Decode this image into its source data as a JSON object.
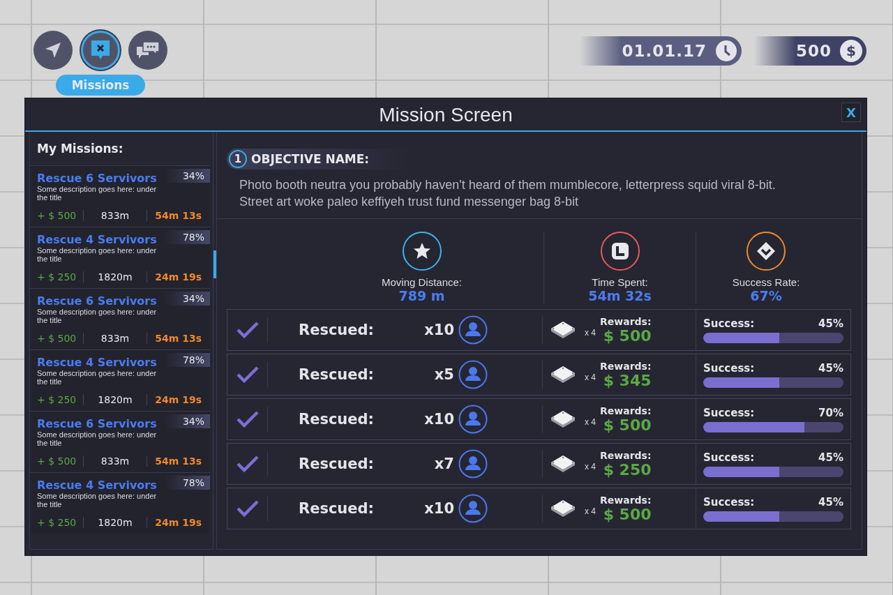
{
  "nav_buttons": [
    {
      "kind": "navigate",
      "selected": false
    },
    {
      "kind": "missions",
      "selected": true
    },
    {
      "kind": "chat",
      "selected": false
    }
  ],
  "tooltip": "Missions",
  "date": "01.01.17",
  "money": {
    "amount": "500",
    "symbol": "$"
  },
  "window": {
    "title": "Mission Screen",
    "close": "X"
  },
  "sidebar": {
    "title": "My Missions:",
    "items": [
      {
        "title": "Rescue 6 Servivors",
        "percent": "34%",
        "description": "Some description goes here: under the title",
        "reward": "+ $ 500",
        "distance": "833m",
        "time": "54m 13s"
      },
      {
        "title": "Rescue 4 Servivors",
        "percent": "78%",
        "description": "Some description goes here: under the title",
        "reward": "+ $ 250",
        "distance": "1820m",
        "time": "24m 19s"
      },
      {
        "title": "Rescue 6 Servivors",
        "percent": "34%",
        "description": "Some description goes here: under the title",
        "reward": "+ $ 500",
        "distance": "833m",
        "time": "54m 13s"
      },
      {
        "title": "Rescue 4 Servivors",
        "percent": "78%",
        "description": "Some description goes here: under the title",
        "reward": "+ $ 250",
        "distance": "1820m",
        "time": "24m 19s"
      },
      {
        "title": "Rescue 6 Servivors",
        "percent": "34%",
        "description": "Some description goes here: under the title",
        "reward": "+ $ 500",
        "distance": "833m",
        "time": "54m 13s"
      },
      {
        "title": "Rescue 4 Servivors",
        "percent": "78%",
        "description": "Some description goes here: under the title",
        "reward": "+ $ 250",
        "distance": "1820m",
        "time": "24m 19s"
      }
    ]
  },
  "objective": {
    "number": "1",
    "title": "OBJECTIVE NAME:",
    "description": "Photo booth neutra you probably haven't heard of them mumblecore, letterpress squid viral 8-bit. Street art woke paleo keffiyeh trust fund messenger bag 8-bit"
  },
  "stats": [
    {
      "kind": "star",
      "color": "#3cb4e8",
      "label": "Moving Distance:",
      "value": "789 m"
    },
    {
      "kind": "clock",
      "color": "#e85a5a",
      "label": "Time Spent:",
      "value": "54m 32s"
    },
    {
      "kind": "diamond",
      "color": "#f0892a",
      "label": "Success Rate:",
      "value": "67%"
    }
  ],
  "rows": [
    {
      "checked": true,
      "label": "Rescued:",
      "count": "x10",
      "multiplier": "x 4",
      "rewards_label": "Rewards:",
      "reward": "$ 500",
      "success_label": "Success:",
      "percent": "45%",
      "level": 0.54
    },
    {
      "checked": true,
      "label": "Rescued:",
      "count": "x5",
      "multiplier": "x 4",
      "rewards_label": "Rewards:",
      "reward": "$ 345",
      "success_label": "Success:",
      "percent": "45%",
      "level": 0.54
    },
    {
      "checked": true,
      "label": "Rescued:",
      "count": "x10",
      "multiplier": "x 4",
      "rewards_label": "Rewards:",
      "reward": "$ 500",
      "success_label": "Success:",
      "percent": "70%",
      "level": 0.72
    },
    {
      "checked": true,
      "label": "Rescued:",
      "count": "x7",
      "multiplier": "x 4",
      "rewards_label": "Rewards:",
      "reward": "$ 250",
      "success_label": "Success:",
      "percent": "45%",
      "level": 0.54
    },
    {
      "checked": true,
      "label": "Rescued:",
      "count": "x10",
      "multiplier": "x 4",
      "rewards_label": "Rewards:",
      "reward": "$ 500",
      "success_label": "Success:",
      "percent": "45%",
      "level": 0.54
    }
  ]
}
